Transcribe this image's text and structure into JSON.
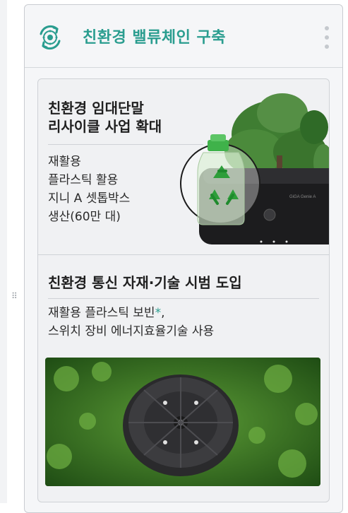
{
  "panel": {
    "title": "친환경 밸류체인 구축",
    "icon": "recycle-icon",
    "menu_icon": "kebab-menu-icon",
    "accent_color": "#2a9d8f"
  },
  "section1": {
    "title_line1": "친환경 임대단말",
    "title_line2": "리사이클 사업 확대",
    "body_lines": [
      "재활용",
      "플라스틱 활용",
      "지니 A 셋톱박스",
      "생산(60만 대)"
    ],
    "illustration": "recycled-bottle-settop-box-tree",
    "device_label": "GiGA Genie A"
  },
  "section2": {
    "title": "친환경 통신 자재·기술 시범 도입",
    "body_line1_main": "재활용 플라스틱 보빈",
    "body_line1_asterisk": "*",
    "body_line1_tail": ",",
    "body_line2": "스위치 장비 에너지효율기술 사용",
    "photo": "plastic-bobbin-on-moss"
  },
  "drag_handle_icon": "drag-handle-icon"
}
